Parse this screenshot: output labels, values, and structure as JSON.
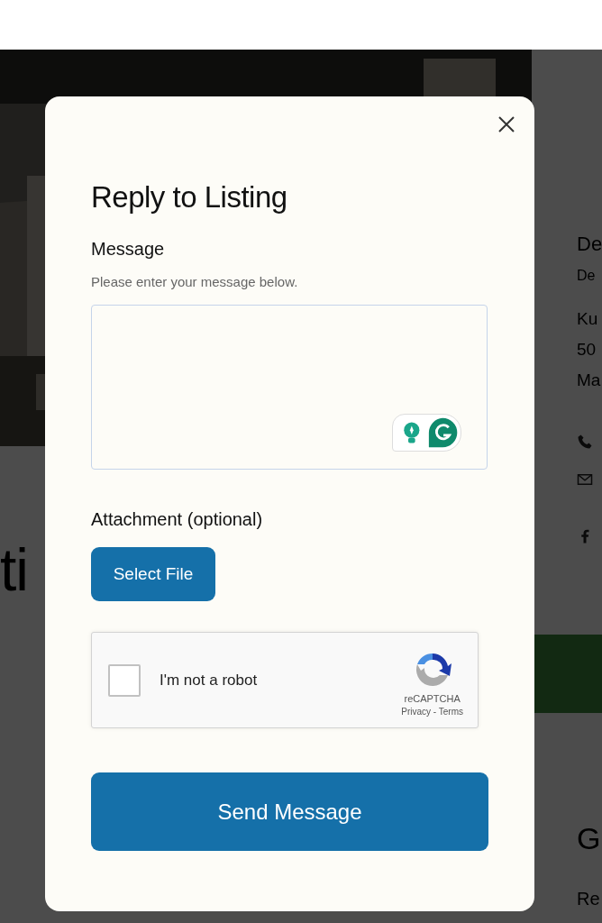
{
  "background": {
    "contact_panel": {
      "heading": "De",
      "subtitle": "De",
      "address_lines": [
        "Ku",
        "50",
        "Ma"
      ]
    },
    "section_heading": "ti",
    "lower_heading": "G",
    "lower_text": "Re"
  },
  "dialog": {
    "title": "Reply to Listing",
    "message_label": "Message",
    "message_hint": "Please enter your message below.",
    "attachment_label": "Attachment (optional)",
    "select_file_button": "Select File",
    "captcha": {
      "label": "I'm not a robot",
      "checked": false,
      "brand": "reCAPTCHA",
      "links": "Privacy - Terms"
    },
    "submit_button": "Send Message"
  }
}
